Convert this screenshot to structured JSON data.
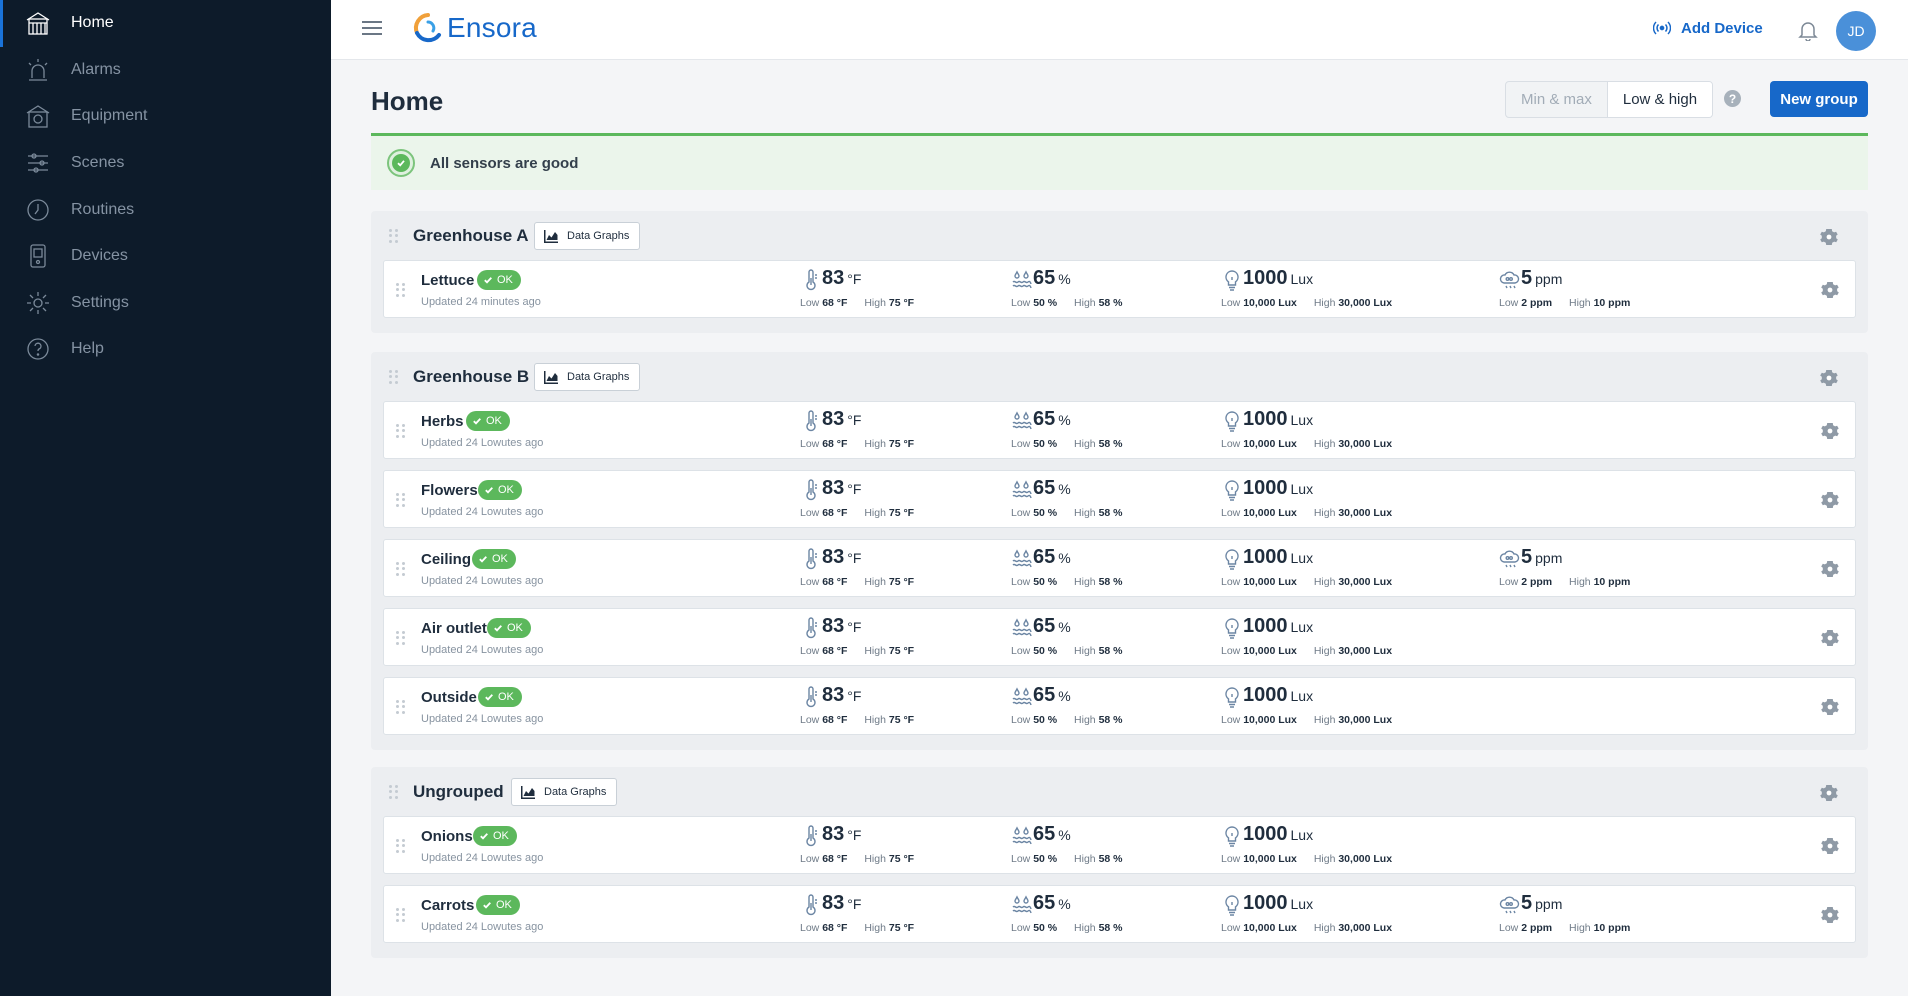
{
  "sidebar": {
    "items": [
      {
        "label": "Home",
        "icon": "home-icon",
        "active": true
      },
      {
        "label": "Alarms",
        "icon": "alarm-icon"
      },
      {
        "label": "Equipment",
        "icon": "equipment-icon"
      },
      {
        "label": "Scenes",
        "icon": "sliders-icon"
      },
      {
        "label": "Routines",
        "icon": "routine-icon"
      },
      {
        "label": "Devices",
        "icon": "device-icon"
      },
      {
        "label": "Settings",
        "icon": "gear-icon"
      },
      {
        "label": "Help",
        "icon": "help-icon"
      }
    ]
  },
  "header": {
    "brand": "Ensora",
    "add_device_label": "Add Device",
    "avatar_initials": "JD"
  },
  "main": {
    "title": "Home",
    "toggle": {
      "min_max": "Min & max",
      "low_high": "Low & high",
      "selected": "low_high"
    },
    "new_group_label": "New group",
    "status_text": "All sensors are good"
  },
  "labels": {
    "low": "Low",
    "high": "High",
    "data_graphs": "Data Graphs"
  },
  "colors": {
    "accent": "#1768c9",
    "ok": "#5cb85c",
    "sidebar": "#0d1b2a"
  },
  "groups": [
    {
      "name": "Greenhouse A",
      "sensors": [
        {
          "name": "Lettuce",
          "status": "OK",
          "updated": "Updated 24 minutes ago",
          "temp": {
            "value": "83",
            "unit": "°F",
            "low": "68 °F",
            "high": "75 °F"
          },
          "humidity": {
            "value": "65",
            "unit": "%",
            "low": "50 %",
            "high": "58 %"
          },
          "light": {
            "value": "1000",
            "unit": "Lux",
            "low": "10,000 Lux",
            "high": "30,000 Lux"
          },
          "co2": {
            "value": "5",
            "unit": "ppm",
            "low": "2 ppm",
            "high": "10 ppm"
          }
        }
      ]
    },
    {
      "name": "Greenhouse B",
      "sensors": [
        {
          "name": "Herbs",
          "status": "OK",
          "updated": "Updated 24 Lowutes ago",
          "temp": {
            "value": "83",
            "unit": "°F",
            "low": "68 °F",
            "high": "75 °F"
          },
          "humidity": {
            "value": "65",
            "unit": "%",
            "low": "50 %",
            "high": "58 %"
          },
          "light": {
            "value": "1000",
            "unit": "Lux",
            "low": "10,000 Lux",
            "high": "30,000 Lux"
          }
        },
        {
          "name": "Flowers",
          "status": "OK",
          "updated": "Updated 24 Lowutes ago",
          "temp": {
            "value": "83",
            "unit": "°F",
            "low": "68 °F",
            "high": "75 °F"
          },
          "humidity": {
            "value": "65",
            "unit": "%",
            "low": "50 %",
            "high": "58 %"
          },
          "light": {
            "value": "1000",
            "unit": "Lux",
            "low": "10,000 Lux",
            "high": "30,000 Lux"
          }
        },
        {
          "name": "Ceiling",
          "status": "OK",
          "updated": "Updated 24 Lowutes ago",
          "temp": {
            "value": "83",
            "unit": "°F",
            "low": "68 °F",
            "high": "75 °F"
          },
          "humidity": {
            "value": "65",
            "unit": "%",
            "low": "50 %",
            "high": "58 %"
          },
          "light": {
            "value": "1000",
            "unit": "Lux",
            "low": "10,000 Lux",
            "high": "30,000 Lux"
          },
          "co2": {
            "value": "5",
            "unit": "ppm",
            "low": "2 ppm",
            "high": "10 ppm"
          }
        },
        {
          "name": "Air outlet",
          "status": "OK",
          "updated": "Updated 24 Lowutes ago",
          "temp": {
            "value": "83",
            "unit": "°F",
            "low": "68 °F",
            "high": "75 °F"
          },
          "humidity": {
            "value": "65",
            "unit": "%",
            "low": "50 %",
            "high": "58 %"
          },
          "light": {
            "value": "1000",
            "unit": "Lux",
            "low": "10,000 Lux",
            "high": "30,000 Lux"
          }
        },
        {
          "name": "Outside",
          "status": "OK",
          "updated": "Updated 24 Lowutes ago",
          "temp": {
            "value": "83",
            "unit": "°F",
            "low": "68 °F",
            "high": "75 °F"
          },
          "humidity": {
            "value": "65",
            "unit": "%",
            "low": "50 %",
            "high": "58 %"
          },
          "light": {
            "value": "1000",
            "unit": "Lux",
            "low": "10,000 Lux",
            "high": "30,000 Lux"
          }
        }
      ]
    },
    {
      "name": "Ungrouped",
      "sensors": [
        {
          "name": "Onions",
          "status": "OK",
          "updated": "Updated 24 Lowutes ago",
          "temp": {
            "value": "83",
            "unit": "°F",
            "low": "68 °F",
            "high": "75 °F"
          },
          "humidity": {
            "value": "65",
            "unit": "%",
            "low": "50 %",
            "high": "58 %"
          },
          "light": {
            "value": "1000",
            "unit": "Lux",
            "low": "10,000 Lux",
            "high": "30,000 Lux"
          }
        },
        {
          "name": "Carrots",
          "status": "OK",
          "updated": "Updated 24 Lowutes ago",
          "temp": {
            "value": "83",
            "unit": "°F",
            "low": "68 °F",
            "high": "75 °F"
          },
          "humidity": {
            "value": "65",
            "unit": "%",
            "low": "50 %",
            "high": "58 %"
          },
          "light": {
            "value": "1000",
            "unit": "Lux",
            "low": "10,000 Lux",
            "high": "30,000 Lux"
          },
          "co2": {
            "value": "5",
            "unit": "ppm",
            "low": "2 ppm",
            "high": "10 ppm"
          }
        }
      ]
    }
  ]
}
